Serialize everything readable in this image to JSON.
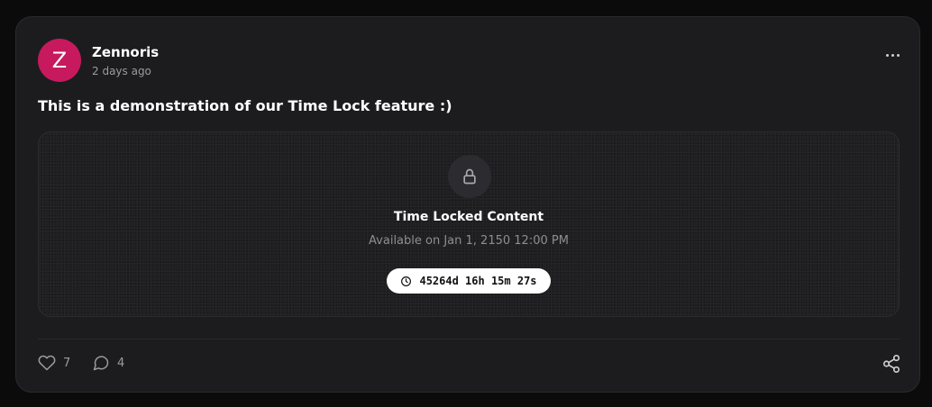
{
  "post": {
    "author": {
      "initial": "Z",
      "name": "Zennoris",
      "time_ago": "2 days ago",
      "avatar_color": "#c7195e"
    },
    "text": "This is a demonstration of our Time Lock feature :)",
    "time_lock": {
      "title": "Time Locked Content",
      "available_text": "Available on Jan 1, 2150 12:00 PM",
      "countdown": "45264d 16h 15m 27s",
      "lock_icon": "lock-icon",
      "clock_icon": "clock-icon"
    },
    "actions": {
      "likes": "7",
      "comments": "4",
      "like_icon": "heart-icon",
      "comment_icon": "speech-bubble-icon",
      "share_icon": "share-icon",
      "more_icon": "ellipsis-icon"
    }
  }
}
